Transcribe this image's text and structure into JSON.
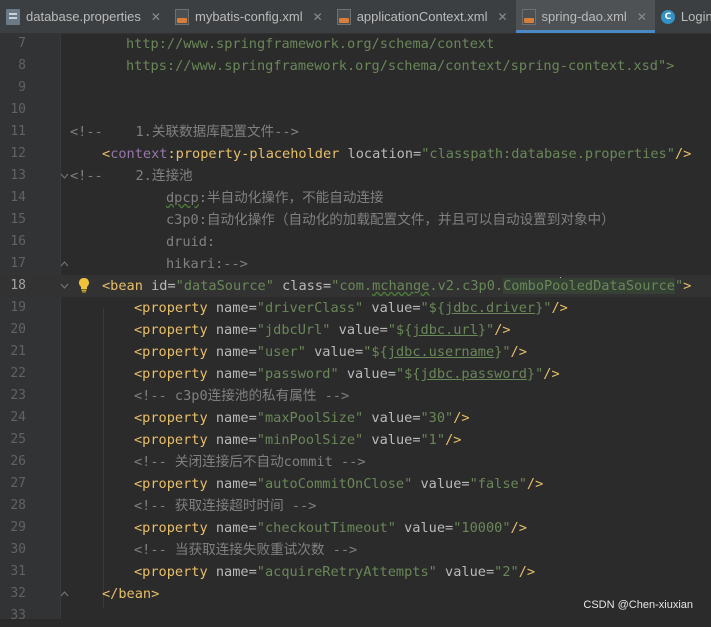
{
  "tabs": [
    {
      "label": "database.properties",
      "icon": "properties-file-icon"
    },
    {
      "label": "mybatis-config.xml",
      "icon": "xml-file-icon"
    },
    {
      "label": "applicationContext.xml",
      "icon": "xml-file-icon"
    },
    {
      "label": "spring-dao.xml",
      "icon": "xml-file-icon",
      "active": true
    },
    {
      "label": "Login",
      "icon": "class-file-icon"
    }
  ],
  "code": {
    "l7": "http://www.springframework.org/schema/context",
    "l8a": "https://www.springframework.org/schema/context/spring-context.xsd",
    "l8b": "\">",
    "l11a": "<!--",
    "l11b": "1.关联数据库配置文件-->",
    "l12_open": "<",
    "l12_ns": "context",
    "l12_tag": ":property-placeholder",
    "l12_attr": "location",
    "l12_eq": "=",
    "l12_val": "\"classpath:database.properties\"",
    "l12_close": "/>",
    "l13a": "<!--",
    "l13b": "2.连接池",
    "l14a": "dpcp",
    "l14b": ":半自动化操作，不能自动连接",
    "l15": "c3p0:自动化操作（自动化的加载配置文件，并且可以自动设置到对象中）",
    "l16": "druid:",
    "l17": "hikari:-->",
    "l18_tag": "<bean",
    "l18_a1": "id",
    "l18_v1": "\"dataSource\"",
    "l18_a2": "class",
    "l18_v2a": "\"com.",
    "l18_v2b": "mchange",
    "l18_v2c": ".v2.c3p0.",
    "l18_v2d": "ComboPo",
    "l18_v2e": "oledDataSource",
    "l18_v2f": "\"",
    "l18_close": ">",
    "l19_a": "\"driverClass\"",
    "l19_v1": "\"${",
    "l19_v2": "jdbc.driver",
    "l19_v3": "}\"",
    "l20_a": "\"jdbcUrl\"",
    "l20_v2": "jdbc.url",
    "l21_a": "\"user\"",
    "l21_v2": "jdbc.username",
    "l22_a": "\"password\"",
    "l22_v2": "jdbc.password",
    "l23": "<!-- c3p0连接池的私有属性 -->",
    "l24_a": "\"maxPoolSize\"",
    "l24_v": "\"30\"",
    "l25_a": "\"minPoolSize\"",
    "l25_v": "\"1\"",
    "l26": "<!-- 关闭连接后不自动commit -->",
    "l27_a": "\"autoCommitOnClose\"",
    "l27_v": "\"false\"",
    "l28": "<!-- 获取连接超时时间 -->",
    "l29_a": "\"checkoutTimeout\"",
    "l29_v": "\"10000\"",
    "l30": "<!-- 当获取连接失败重试次数 -->",
    "l31_a": "\"acquireRetryAttempts\"",
    "l31_v": "\"2\"",
    "l32": "</bean>",
    "prop_tag": "<property",
    "name_attr": "name",
    "value_attr": "value",
    "eq": "=",
    "self_close": "/>"
  },
  "line_numbers": [
    "7",
    "8",
    "9",
    "10",
    "11",
    "12",
    "13",
    "14",
    "15",
    "16",
    "17",
    "18",
    "19",
    "20",
    "21",
    "22",
    "23",
    "24",
    "25",
    "26",
    "27",
    "28",
    "29",
    "30",
    "31",
    "32",
    "33"
  ],
  "watermark": "CSDN @Chen-xiuxian"
}
